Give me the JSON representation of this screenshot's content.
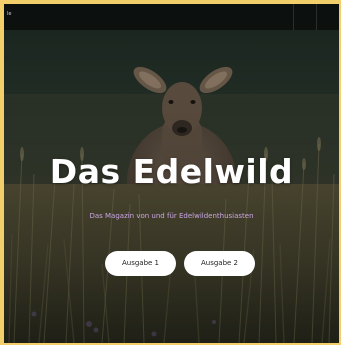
{
  "topbar": {
    "text": "le"
  },
  "hero": {
    "title": "Das Edelwild",
    "subtitle": "Das Magazin von und für Edelwildenthusiasten"
  },
  "buttons": {
    "issue_1": "Ausgabe 1",
    "issue_2": "Ausgabe 2"
  },
  "colors": {
    "frame_border": "#f2cf6a",
    "subtitle": "#c9a6e3",
    "button_bg": "#ffffff"
  }
}
